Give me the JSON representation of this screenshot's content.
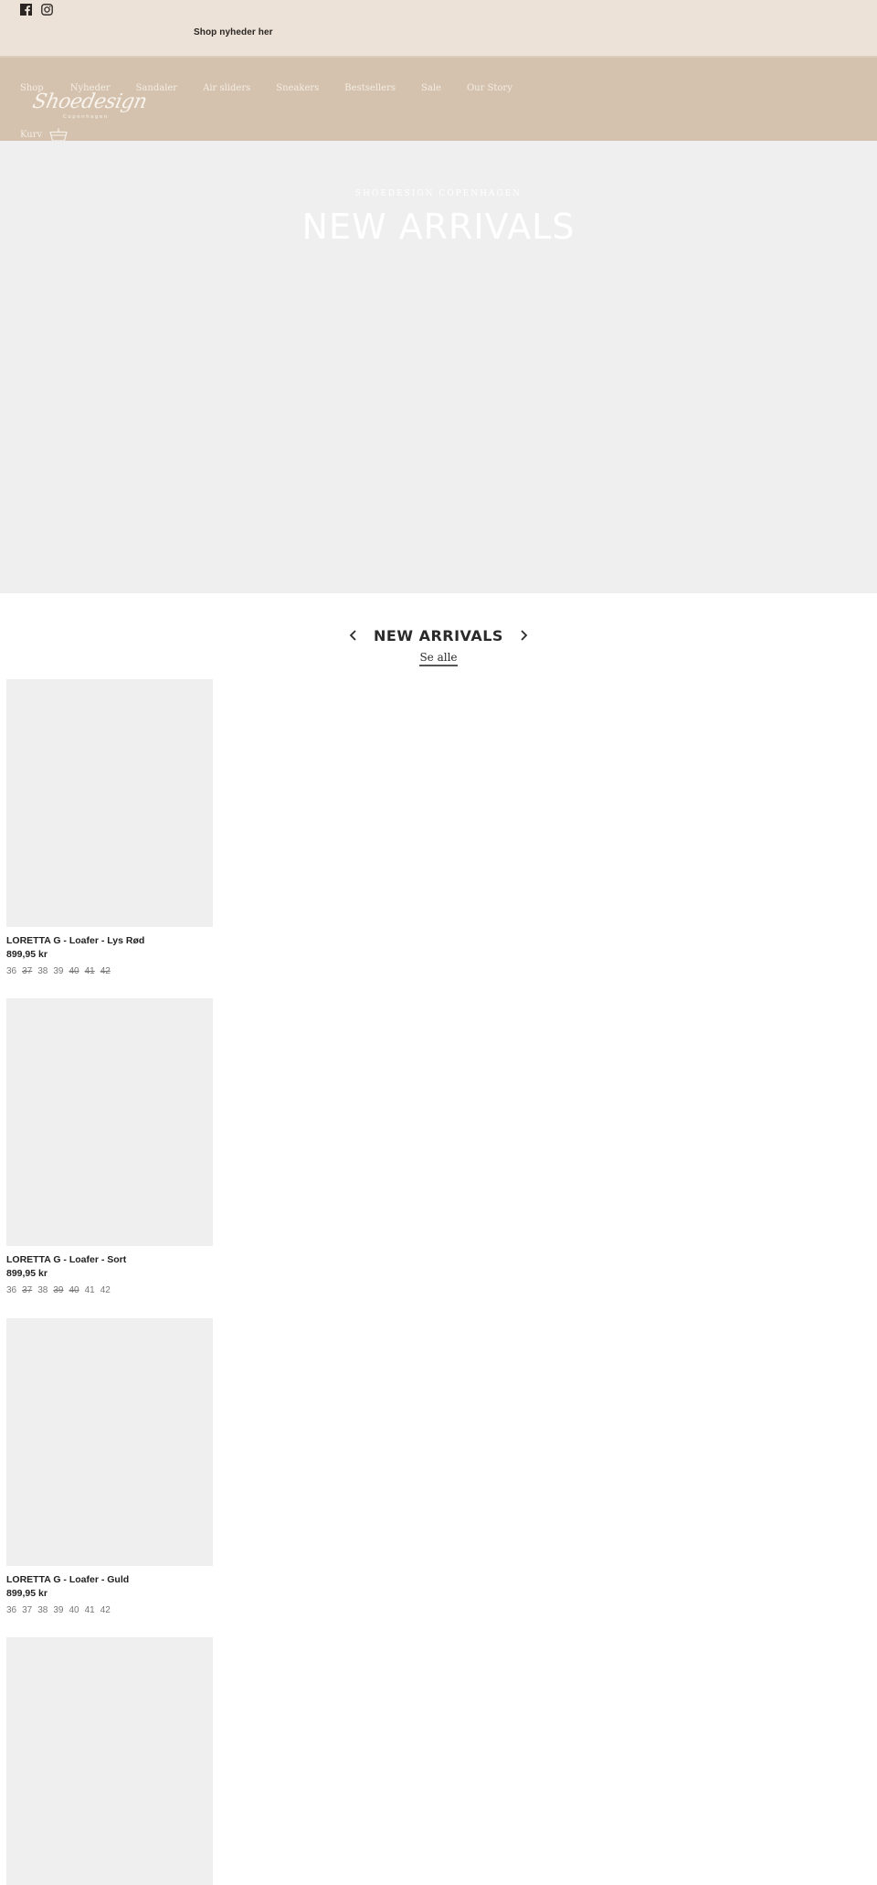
{
  "topbar": {
    "social": [
      {
        "icon": "facebook-icon",
        "label": "Facebook"
      },
      {
        "icon": "instagram-icon",
        "label": "Instagram"
      }
    ],
    "announcement": "Shop nyheder her"
  },
  "header": {
    "nav": [
      "Shop",
      "Nyheder",
      "Sandaler",
      "Air sliders",
      "Sneakers",
      "Bestsellers",
      "Sale",
      "Our Story"
    ],
    "logo": {
      "script": "Shoedesign",
      "sub": "Copenhagen"
    },
    "cart_label": "Kurv",
    "cart_icon": "basket-icon"
  },
  "hero": {
    "kicker": "SHOEDESIGN COPENHAGEN",
    "title": "NEW ARRIVALS"
  },
  "collection": {
    "title": "NEW ARRIVALS",
    "see_all": "Se alle",
    "prev_icon": "chevron-left-icon",
    "next_icon": "chevron-right-icon"
  },
  "products": [
    {
      "name": "LORETTA G - Loafer - Lys Rød",
      "price": "899,95 kr",
      "sizes": [
        {
          "size": "36",
          "available": true
        },
        {
          "size": "37",
          "available": false
        },
        {
          "size": "38",
          "available": true
        },
        {
          "size": "39",
          "available": true
        },
        {
          "size": "40",
          "available": false
        },
        {
          "size": "41",
          "available": false
        },
        {
          "size": "42",
          "available": false
        }
      ]
    },
    {
      "name": "LORETTA G - Loafer - Sort",
      "price": "899,95 kr",
      "sizes": [
        {
          "size": "36",
          "available": true
        },
        {
          "size": "37",
          "available": false
        },
        {
          "size": "38",
          "available": true
        },
        {
          "size": "39",
          "available": false
        },
        {
          "size": "40",
          "available": false
        },
        {
          "size": "41",
          "available": true
        },
        {
          "size": "42",
          "available": true
        }
      ]
    },
    {
      "name": "LORETTA G - Loafer - Guld",
      "price": "899,95 kr",
      "sizes": [
        {
          "size": "36",
          "available": true
        },
        {
          "size": "37",
          "available": true
        },
        {
          "size": "38",
          "available": true
        },
        {
          "size": "39",
          "available": true
        },
        {
          "size": "40",
          "available": true
        },
        {
          "size": "41",
          "available": true
        },
        {
          "size": "42",
          "available": true
        }
      ]
    },
    {
      "name": "",
      "price": "",
      "sizes": []
    }
  ],
  "colors": {
    "topbar_bg": "#ece2d7",
    "navbar_bg": "#d4c2ae",
    "hero_bg": "#efefef",
    "text_dark": "#2a2a2a"
  }
}
